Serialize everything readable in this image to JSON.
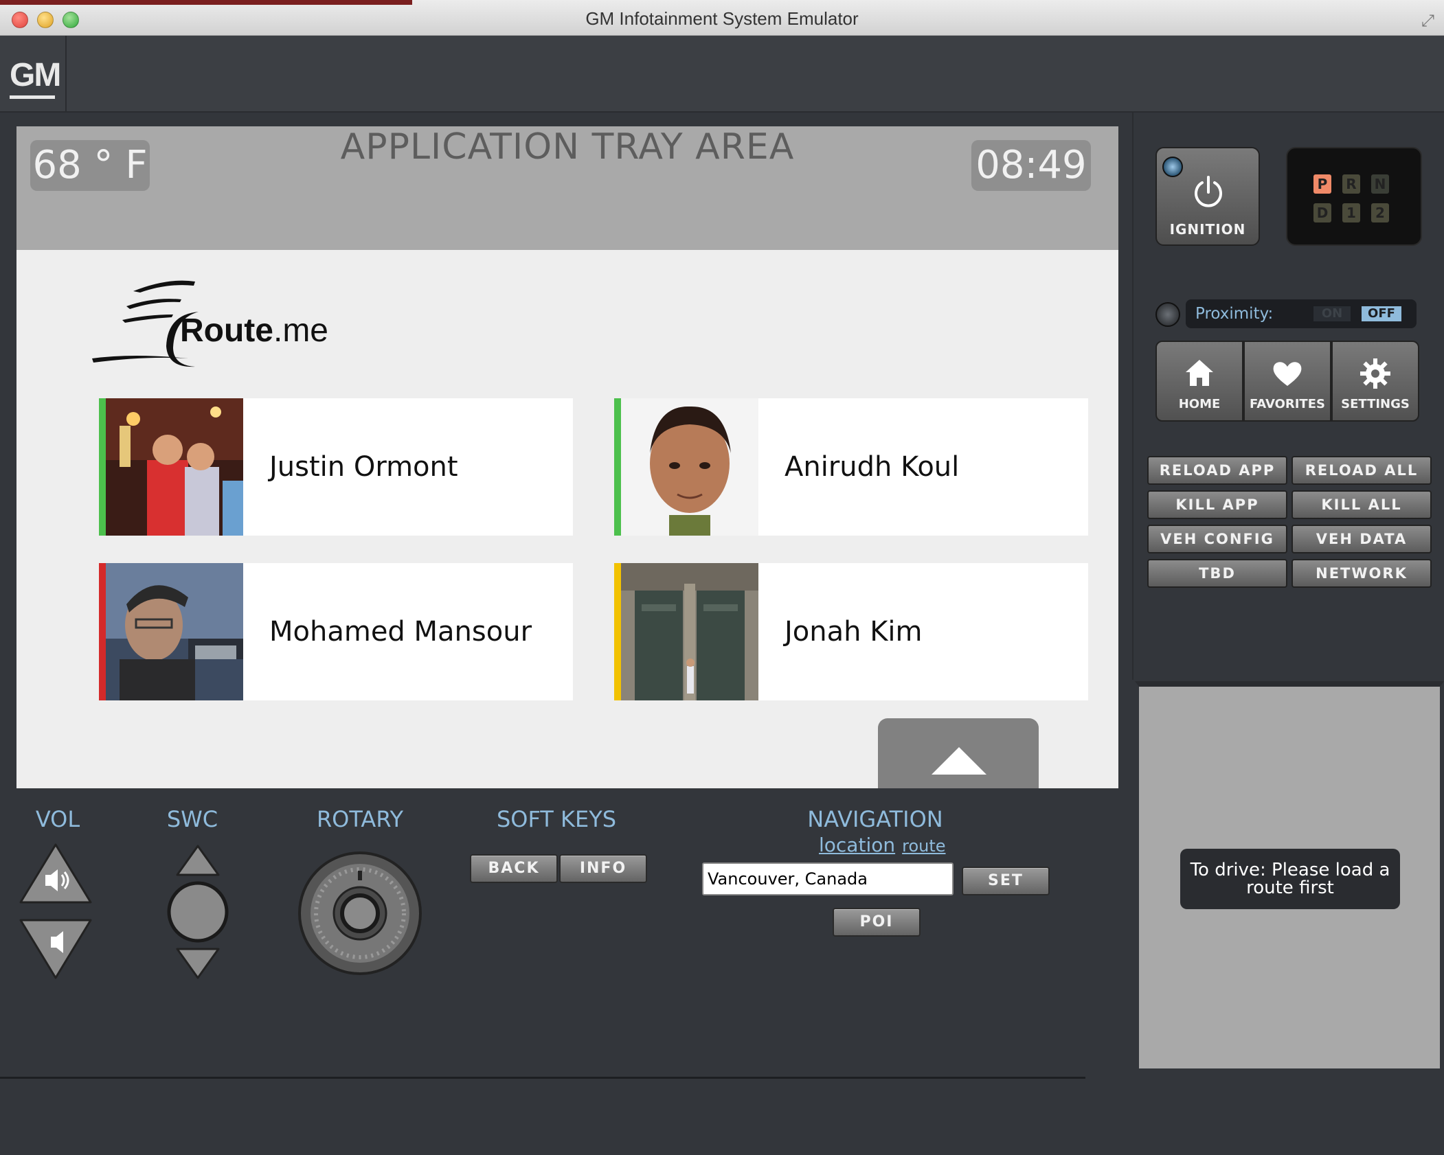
{
  "window": {
    "title": "GM Infotainment System Emulator"
  },
  "brand": {
    "logo": "GM"
  },
  "tray": {
    "title": "APPLICATION TRAY AREA",
    "temperature": "68 ° F",
    "time": "08:49"
  },
  "app": {
    "logo_text_bold": "Route",
    "logo_text_rest": ".me",
    "contacts": [
      {
        "name": "Justin Ormont",
        "status_color": "#4cc04c"
      },
      {
        "name": "Anirudh Koul",
        "status_color": "#4cc04c"
      },
      {
        "name": "Mohamed Mansour",
        "status_color": "#d42a2a"
      },
      {
        "name": "Jonah Kim",
        "status_color": "#f2c200"
      }
    ]
  },
  "controls": {
    "vol_label": "VOL",
    "swc_label": "SWC",
    "rotary_label": "ROTARY",
    "softkeys_label": "SOFT KEYS",
    "back_label": "BACK",
    "info_label": "INFO",
    "navigation_label": "NAVIGATION",
    "location_link": "location",
    "route_link": "route",
    "nav_input_value": "Vancouver, Canada",
    "set_label": "SET",
    "poi_label": "POI"
  },
  "panel": {
    "ignition_label": "IGNITION",
    "gears": [
      "P",
      "R",
      "N",
      "D",
      "1",
      "2"
    ],
    "active_gear": "P",
    "proximity_label": "Proximity:",
    "proximity_on": "ON",
    "proximity_off": "OFF",
    "home_label": "HOME",
    "favorites_label": "FAVORITES",
    "settings_label": "SETTINGS",
    "utility_buttons": [
      "RELOAD APP",
      "RELOAD ALL",
      "KILL APP",
      "KILL ALL",
      "VEH CONFIG",
      "VEH DATA",
      "TBD",
      "NETWORK"
    ],
    "drive_message": "To drive: Please load a route first"
  },
  "colors": {
    "accent_label": "#8fbbdc",
    "background": "#33363b",
    "tray": "#a9a9a9",
    "screen": "#eeeeee"
  }
}
